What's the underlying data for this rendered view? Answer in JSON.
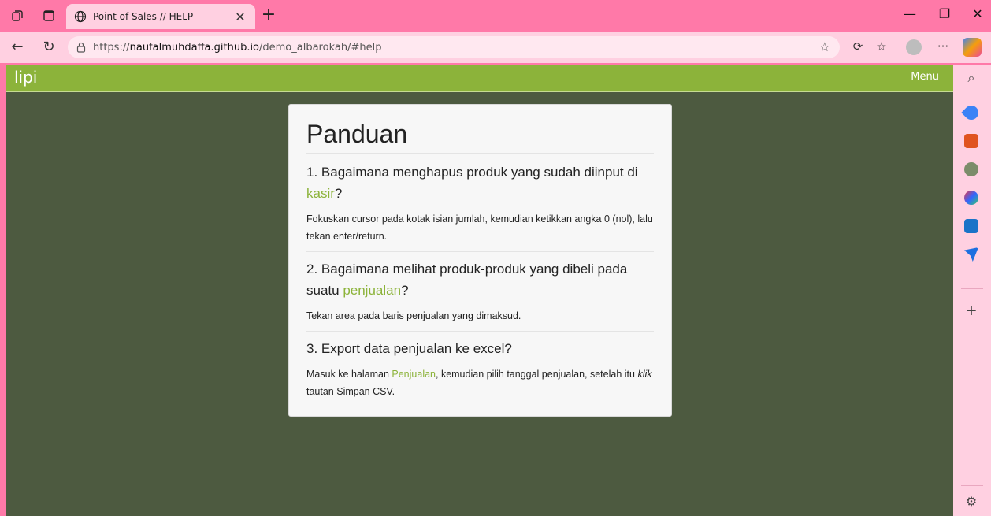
{
  "browser": {
    "tab": {
      "title": "Point of Sales // HELP",
      "close": "✕"
    },
    "new_tab": "+",
    "window_controls": {
      "minimize": "—",
      "restore": "❐",
      "close": "✕"
    },
    "address": {
      "prefix": "https://",
      "host": "naufalmuhdaffa.github.io",
      "path": "/demo_albarokah/#help"
    },
    "toolbar_icons": [
      "extensions-icon",
      "favorites-icon",
      "profile-icon",
      "more-icon",
      "copilot-icon"
    ],
    "more_label": "···",
    "sidepanel_icons": [
      "search-icon",
      "tag-icon",
      "toolbox-icon",
      "people-icon",
      "office-icon",
      "outlook-icon",
      "send-icon",
      "add-icon",
      "settings-icon"
    ]
  },
  "app": {
    "brand": "lipi",
    "menu": "Menu"
  },
  "help": {
    "title": "Panduan",
    "items": [
      {
        "q_pre": "1. Bagaimana menghapus produk yang sudah diinput di ",
        "q_link": "kasir",
        "q_post": "?",
        "a_pre": "Fokuskan cursor pada kotak isian jumlah, kemudian ketikkan angka 0 (nol), lalu tekan enter/return."
      },
      {
        "q_pre": "2. Bagaimana melihat produk-produk yang dibeli pada suatu ",
        "q_link": "penjualan",
        "q_post": "?",
        "a_pre": "Tekan area pada baris penjualan yang dimaksud."
      },
      {
        "q_pre": "3. Export data penjualan ke excel?",
        "a_pre": "Masuk ke halaman ",
        "a_link": "Penjualan",
        "a_mid": ", kemudian pilih tanggal penjualan, setelah itu ",
        "a_em": "klik",
        "a_post": " tautan Simpan CSV."
      }
    ]
  },
  "colors": {
    "tabbar": "#ff79a8",
    "addressbar": "#ffd0e1",
    "navbar": "#8cb33a",
    "page_bg": "#4d5a40",
    "link": "#8cb33a"
  }
}
